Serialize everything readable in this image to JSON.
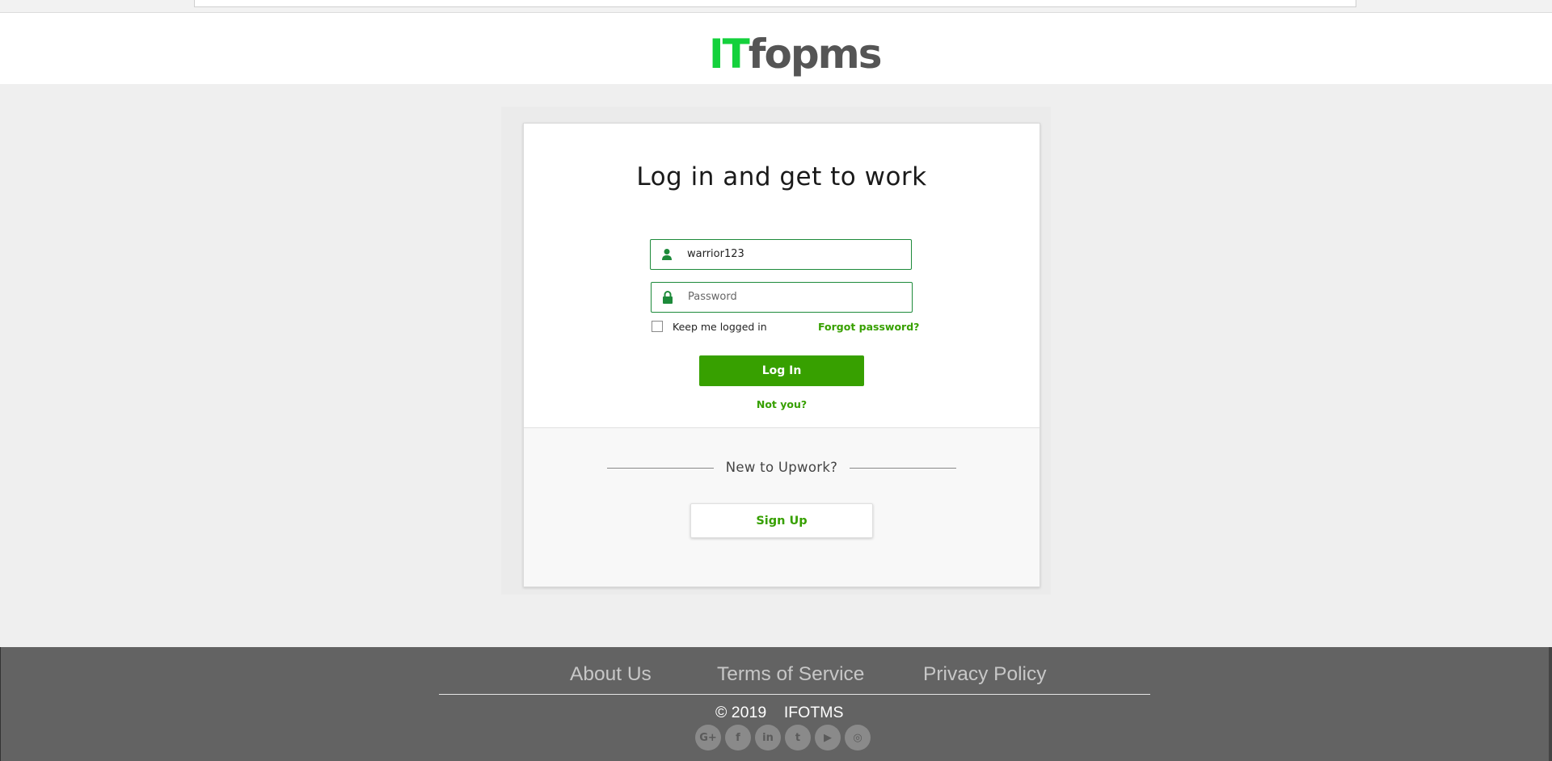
{
  "header": {
    "logo_part1": "IT",
    "logo_part2": "fopms"
  },
  "login": {
    "title": "Log in and get to work",
    "username_value": "warrior123",
    "password_placeholder": "Password",
    "remember_label": "Keep me logged in",
    "forgot_label": "Forgot password?",
    "login_button": "Log In",
    "not_you": "Not you?"
  },
  "signup": {
    "prompt": "New to Upwork?",
    "button": "Sign Up"
  },
  "footer": {
    "links": [
      "About Us",
      "Terms of Service",
      "Privacy Policy"
    ],
    "copyright": "© 2019",
    "brand": "IFOTMS",
    "social": [
      {
        "icon": "google-plus-icon",
        "glyph": "G+"
      },
      {
        "icon": "facebook-icon",
        "glyph": "f"
      },
      {
        "icon": "linkedin-icon",
        "glyph": "in"
      },
      {
        "icon": "twitter-icon",
        "glyph": "t"
      },
      {
        "icon": "youtube-icon",
        "glyph": "▶"
      },
      {
        "icon": "instagram-icon",
        "glyph": "◎"
      }
    ]
  },
  "colors": {
    "accent": "#37a000",
    "field_border": "#1d8a3a",
    "logo_green": "#14d13c",
    "footer_bg": "#636363"
  }
}
